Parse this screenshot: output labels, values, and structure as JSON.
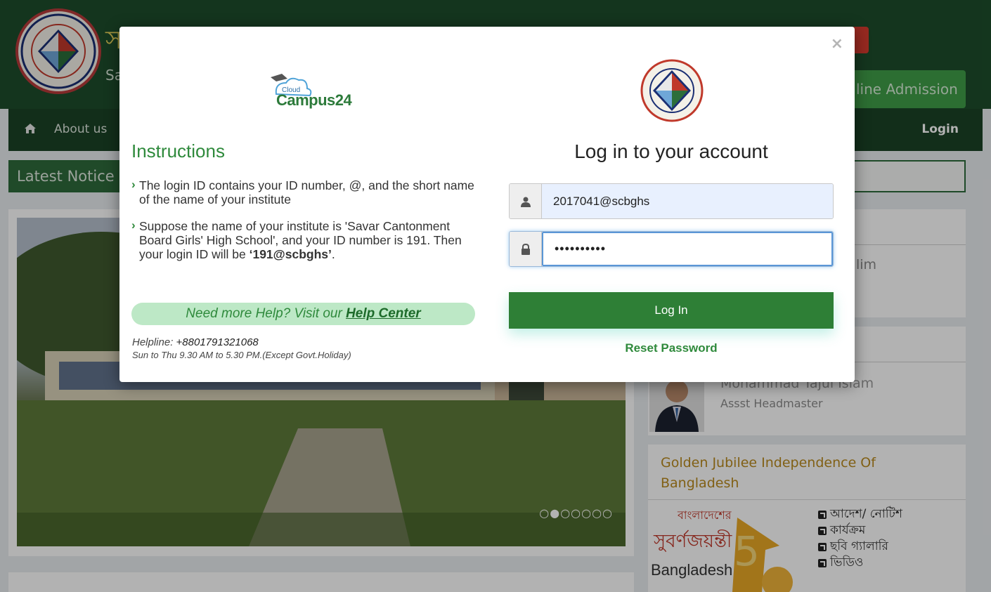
{
  "site": {
    "bangla_title_fragment": "স",
    "title_fragment": "Sa",
    "online_admission": "line Admission",
    "nav": {
      "about": "About us",
      "login": "Login"
    },
    "notice_label": "Latest Notice",
    "slider_dots": "○●○○○○○",
    "card1_fragment": "lim",
    "person": {
      "name": "Mohammad Tajul Islam",
      "role": "Assst Headmaster"
    },
    "jubilee": {
      "title": "Golden Jubilee Independence Of Bangladesh",
      "logo_text_bangla": "বাংলাদেশের",
      "logo_text_bangla2": "সুবর্ণজয়ন্তী",
      "logo_text": "Bangladesh",
      "links": [
        "আদেশ/ নোটিশ",
        "কার্যক্রম",
        "ছবি গ্যালারি",
        "ভিডিও"
      ]
    }
  },
  "modal": {
    "close_label": "×",
    "left": {
      "brand_small": "Cloud",
      "brand": "Campus24",
      "instructions_title": "Instructions",
      "items": [
        {
          "text": "The login ID contains your ID number, @, and the short name of the name of your institute",
          "bold": ""
        },
        {
          "text": "Suppose the name of your institute is 'Savar Cantonment Board Girls' High School', and your ID number is 191. Then your login ID will be ",
          "bold": "‘191@scbghs’",
          "after": "."
        }
      ],
      "help_prefix": "Need more Help? Visit our ",
      "help_link": "Help Center",
      "helpline_label": "Helpline: ",
      "helpline_number": "+8801791321068",
      "helpline_hours": "Sun to Thu 9.30 AM to 5.30 PM.(Except Govt.Holiday)"
    },
    "right": {
      "title": "Log in to your account",
      "username_value": "2017041@scbghs",
      "password_value": "••••••••••",
      "login_button": "Log In",
      "reset_link": "Reset Password"
    }
  },
  "colors": {
    "brand_green": "#2e7f36",
    "header_green": "#1d4d2b",
    "help_pill": "#bde8c6",
    "jubilee_gold": "#b98a1f"
  },
  "icons": {
    "user": "user-icon",
    "lock": "lock-icon",
    "home": "home-icon",
    "close": "close-icon"
  }
}
